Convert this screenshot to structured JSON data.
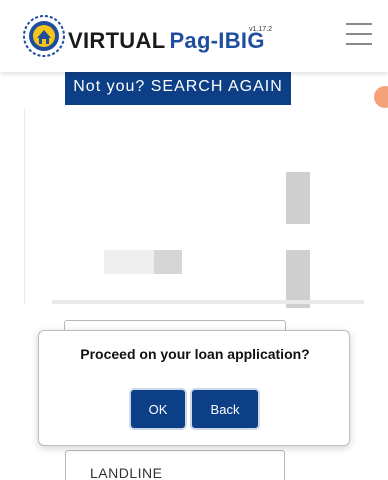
{
  "header": {
    "brand_part1": "VIRTUAL",
    "brand_part2": "Pag-IBIG",
    "version": "v1.17.2",
    "menu_icon": "hamburger-menu-icon",
    "logo_icon": "pagibig-seal-logo"
  },
  "search_again_label": "Not you? SEARCH AGAIN",
  "form": {
    "landline_label": "LANDLINE"
  },
  "modal": {
    "title": "Proceed on your loan application?",
    "ok_label": "OK",
    "back_label": "Back"
  },
  "colors": {
    "primary": "#0d3f86",
    "brand_blue": "#1f4e9e",
    "accent_dot": "#f4a27c"
  }
}
